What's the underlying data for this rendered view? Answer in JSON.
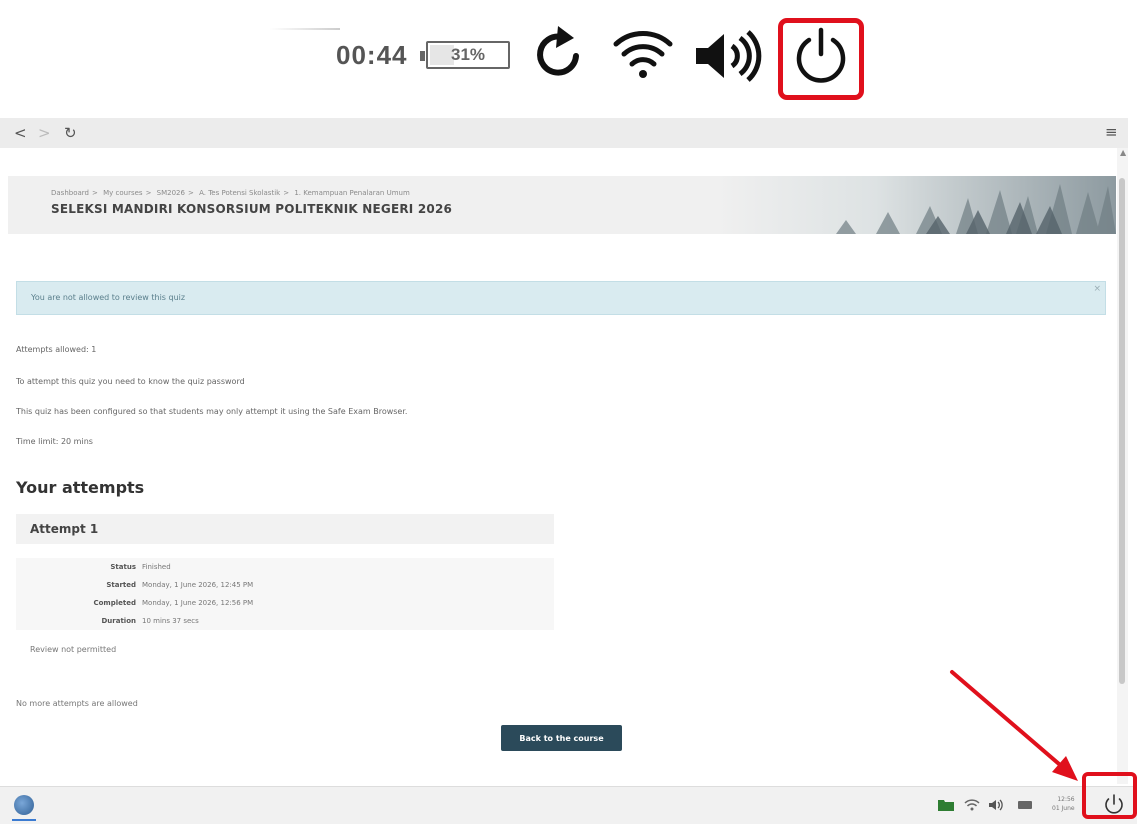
{
  "zoom_tray": {
    "clock": "00:44",
    "battery_label": "31%",
    "battery_level": 0.31,
    "icons": [
      "reload-icon",
      "wifi-icon",
      "volume-icon",
      "power-icon"
    ],
    "highlight_color": "#e0101c"
  },
  "navbar": {
    "back": "<",
    "forward": ">",
    "reload": "↻",
    "menu": "≡"
  },
  "header": {
    "breadcrumb": [
      "Dashboard",
      "My courses",
      "SM2026",
      "A. Tes Potensi Skolastik",
      "1. Kemampuan Penalaran Umum"
    ],
    "breadcrumb_sep": ">",
    "title": "SELEKSI MANDIRI KONSORSIUM POLITEKNIK NEGERI 2026"
  },
  "alert": {
    "message": "You are not allowed to review this quiz",
    "close": "×"
  },
  "quiz_info": {
    "attempts_allowed": "Attempts allowed: 1",
    "password_note": "To attempt this quiz you need to know the quiz password",
    "seb_note": "This quiz has been configured so that students may only attempt it using the Safe Exam Browser.",
    "time_limit": "Time limit: 20 mins"
  },
  "attempts": {
    "heading": "Your attempts",
    "card_title": "Attempt 1",
    "rows": [
      {
        "label": "Status",
        "value": "Finished"
      },
      {
        "label": "Started",
        "value": "Monday, 1 June 2026, 12:45 PM"
      },
      {
        "label": "Completed",
        "value": "Monday, 1 June 2026, 12:56 PM"
      },
      {
        "label": "Duration",
        "value": "10 mins 37 secs"
      }
    ],
    "review_note": "Review not permitted"
  },
  "footer": {
    "no_more": "No more attempts are allowed",
    "back_button": "Back to the course"
  },
  "taskbar": {
    "clock_time": "12:56",
    "clock_date": "01 June",
    "tray_icons": [
      "folder-icon",
      "wifi-icon",
      "volume-icon",
      "keyboard-icon"
    ]
  },
  "colors": {
    "button_bg": "#2b4a5a",
    "alert_bg": "#d9ebf0",
    "highlight": "#e0101c"
  }
}
